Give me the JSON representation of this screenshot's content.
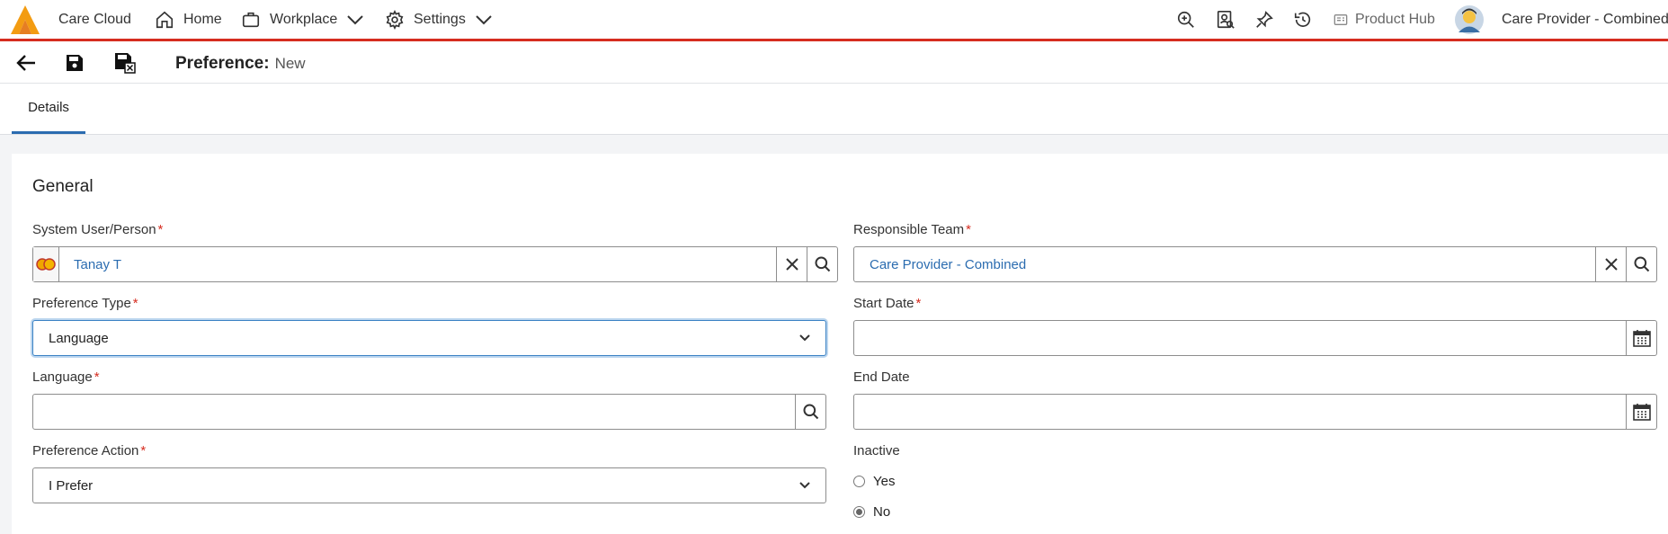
{
  "topbar": {
    "app_name": "Care Cloud",
    "nav": [
      {
        "label": "Home",
        "icon": "home-icon"
      },
      {
        "label": "Workplace",
        "icon": "briefcase-icon"
      },
      {
        "label": "Settings",
        "icon": "gear-icon"
      }
    ],
    "product_hub": "Product Hub",
    "user_name": "Care Provider - Combined"
  },
  "toolbar": {
    "page_title": "Preference:",
    "record_label": "New"
  },
  "tabs": [
    {
      "label": "Details",
      "active": true
    }
  ],
  "form": {
    "section_title": "General",
    "system_user": {
      "label": "System User/Person",
      "value": "Tanay T",
      "required": true
    },
    "responsible_team": {
      "label": "Responsible Team",
      "value": "Care Provider - Combined",
      "required": true
    },
    "preference_type": {
      "label": "Preference Type",
      "value": "Language",
      "required": true
    },
    "start_date": {
      "label": "Start Date",
      "value": "",
      "required": true
    },
    "language": {
      "label": "Language",
      "value": "",
      "required": true
    },
    "end_date": {
      "label": "End Date",
      "value": "",
      "required": false
    },
    "preference_action": {
      "label": "Preference Action",
      "value": "I Prefer",
      "required": true
    },
    "inactive": {
      "label": "Inactive",
      "options": [
        "Yes",
        "No"
      ],
      "selected": "No"
    }
  },
  "colors": {
    "brand_red": "#d62d20",
    "link_blue": "#2b6cb0",
    "logo_orange": "#f39c12"
  }
}
